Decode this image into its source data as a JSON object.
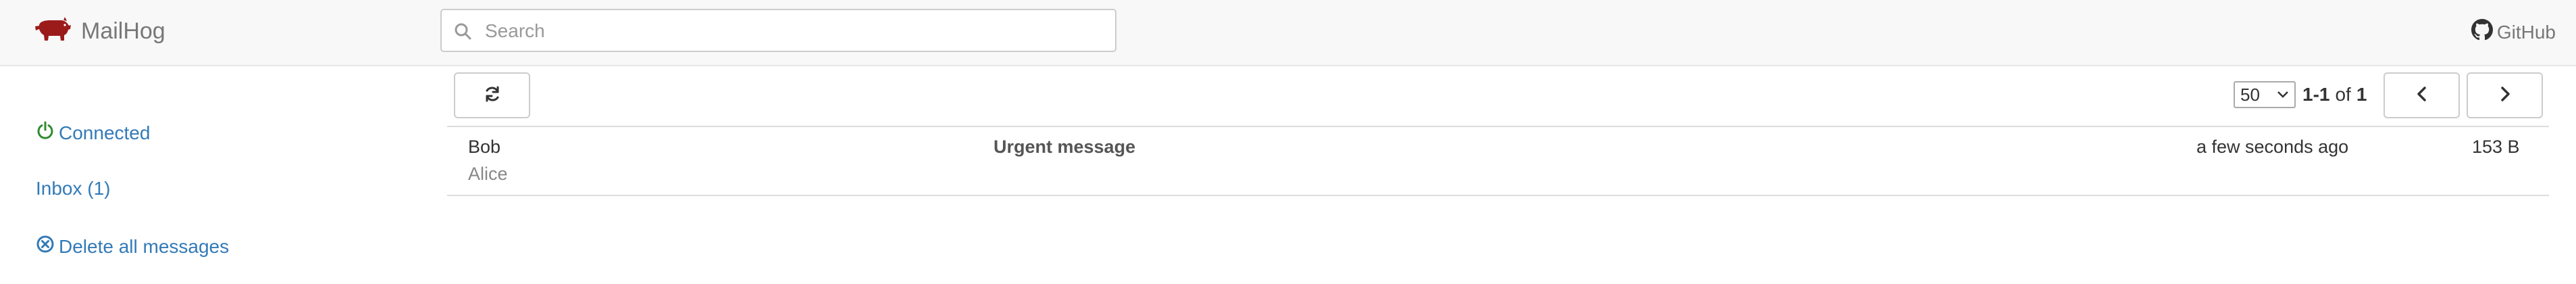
{
  "header": {
    "brand": "MailHog",
    "brand_icon": "pig-icon",
    "brand_color": "#9b1b1b",
    "search_placeholder": "Search",
    "search_value": "",
    "github_label": "GitHub"
  },
  "sidebar": {
    "connected_label": "Connected",
    "connected_color": "#2e8b2e",
    "inbox_label": "Inbox (1)",
    "delete_label": "Delete all messages",
    "link_color": "#337ab7"
  },
  "toolbar": {
    "page_size": "50",
    "range": "1-1",
    "of_label": "of",
    "total": "1"
  },
  "messages": [
    {
      "from": "Bob",
      "to": "Alice",
      "subject": "Urgent message",
      "time": "a few seconds ago",
      "size": "153 B"
    }
  ]
}
